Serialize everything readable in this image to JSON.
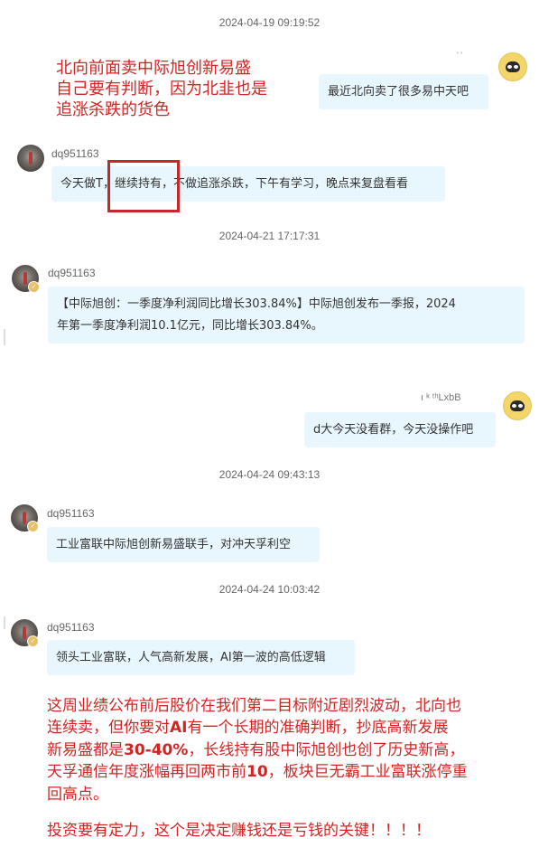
{
  "chat": {
    "timestamps": [
      "2024-04-19 09:19:52",
      "2024-04-21 17:17:31",
      "2024-04-24 09:43:13",
      "2024-04-24 10:03:42"
    ],
    "self_name_1": "' '",
    "self_name_2": "ı ᵏ ᵗʰLxbB",
    "other_name": "dq951163",
    "messages": {
      "m1": "最近北向卖了很多易中天吧",
      "m2": "今天做T，继续持有，不做追涨杀跌，下午有学习，晚点来复盘看看",
      "m3_line1": "【中际旭创：一季度净利润同比增长303.84%】中际旭创发布一季报，2024",
      "m3_line2": "年第一季度净利润10.1亿元，同比增长303.84%。",
      "m4": "d大今天没看群，今天没操作吧",
      "m5": "工业富联中际旭创新易盛联手，对冲天孚利空",
      "m6": "领头工业富联，人气高新发展，AI第一波的高低逻辑"
    }
  },
  "annotations": {
    "top_note": {
      "line1": "北向前面卖中际旭创新易盛",
      "line2": "自己要有判断，因为北韭也是",
      "line3": "追涨杀跌的货色"
    },
    "bottom_note": {
      "p1_l1": "这周业绩公布前后股价在我们第二目标附近剧烈波动，北向也",
      "p1_l2_a": "连续卖，但你要对",
      "p1_l2_b": "AI",
      "p1_l2_c": "有一个长期的准确判断，抄底高新发展",
      "p1_l3_a": "新易盛都是",
      "p1_l3_b": "30-40%",
      "p1_l3_c": "，长线持有股中际旭创也创了历史新高，",
      "p1_l4_a": "天孚通信年度涨幅再回两市前",
      "p1_l4_b": "10",
      "p1_l4_c": "，板块巨无霸工业富联涨停重",
      "p1_l5": "回高点。",
      "p2": "投资要有定力，这个是决定赚钱还是亏钱的关键！！！！"
    }
  },
  "colors": {
    "bubble_bg": "#e8f6fd",
    "annotation_red": "#d42323",
    "highlight_box": "#c8262b"
  }
}
